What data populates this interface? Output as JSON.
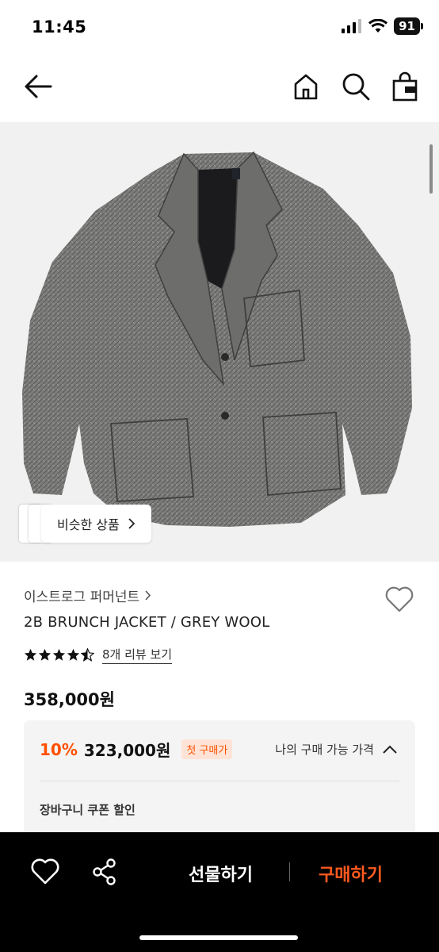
{
  "status": {
    "time": "11:45",
    "battery": "91"
  },
  "nav": {
    "back": "back-icon",
    "home": "home-icon",
    "search": "search-icon",
    "bag": "bag-icon"
  },
  "product": {
    "similar_label": "비슷한 상품",
    "brand": "이스트로그 퍼머넌트",
    "title": "2B BRUNCH JACKET / GREY WOOL",
    "rating": 4.5,
    "review_link": "8개 리뷰 보기",
    "price": "358,000원"
  },
  "price_card": {
    "discount_pct": "10%",
    "discount_price": "323,000원",
    "first_badge": "첫 구매가",
    "avail_label": "나의 구매 가능 가격",
    "coupon_label": "장바구니 쿠폰 할인"
  },
  "bottom_bar": {
    "gift_label": "선물하기",
    "buy_label": "구매하기"
  },
  "colors": {
    "accent": "#ff5000",
    "buy": "#ff5a1f",
    "bar_bg": "#000000"
  }
}
